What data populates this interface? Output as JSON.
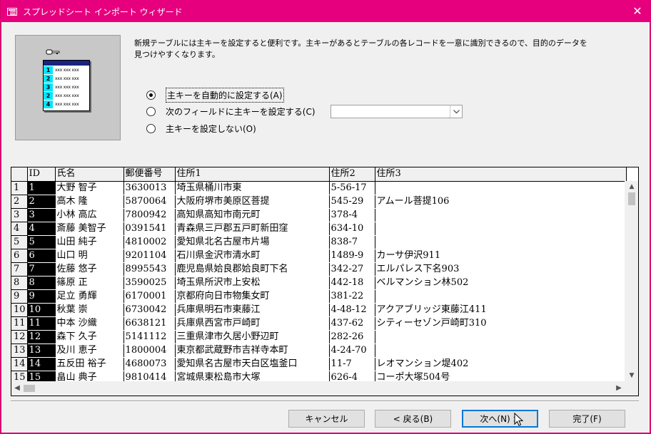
{
  "window": {
    "title": "スプレッドシート インポート ウィザード",
    "close_glyph": "✕"
  },
  "preview": {
    "row_keys": [
      "1",
      "2",
      "3",
      "2",
      "4"
    ],
    "cell_text": "xxx xxx xxx"
  },
  "description": "新規テーブルには主キーを設定すると便利です。主キーがあるとテーブルの各レコードを一意に識別できるので、目的のデータを見つけやすくなります。",
  "options": [
    {
      "label": "主キーを自動的に設定する(A)",
      "checked": true
    },
    {
      "label": "次のフィールドに主キーを設定する(C)",
      "checked": false
    },
    {
      "label": "主キーを設定しない(O)",
      "checked": false
    }
  ],
  "field_combo": {
    "value": ""
  },
  "grid": {
    "columns": [
      "",
      "ID",
      "氏名",
      "郵便番号",
      "住所1",
      "住所2",
      "住所3"
    ],
    "rows": [
      [
        "1",
        "1",
        "大野 智子",
        "3630013",
        "埼玉県桶川市東",
        "5-56-17",
        ""
      ],
      [
        "2",
        "2",
        "高木 隆",
        "5870064",
        "大阪府堺市美原区菩提",
        "545-29",
        "アムール菩提106"
      ],
      [
        "3",
        "3",
        "小林 高広",
        "7800942",
        "高知県高知市南元町",
        "378-4",
        ""
      ],
      [
        "4",
        "4",
        "斎藤 美智子",
        "0391541",
        "青森県三戸郡五戸町新田窪",
        "634-10",
        ""
      ],
      [
        "5",
        "5",
        "山田 純子",
        "4810002",
        "愛知県北名古屋市片場",
        "838-7",
        ""
      ],
      [
        "6",
        "6",
        "山口 明",
        "9201104",
        "石川県金沢市清水町",
        "1489-9",
        "カーサ伊沢911"
      ],
      [
        "7",
        "7",
        "佐藤 悠子",
        "8995543",
        "鹿児島県姶良郡姶良町下名",
        "342-27",
        "エルパレス下名903"
      ],
      [
        "8",
        "8",
        "篠原 正",
        "3590025",
        "埼玉県所沢市上安松",
        "442-18",
        "ベルマンション林502"
      ],
      [
        "9",
        "9",
        "足立 勇輝",
        "6170001",
        "京都府向日市物集女町",
        "381-22",
        ""
      ],
      [
        "10",
        "10",
        "秋葉 崇",
        "6730042",
        "兵庫県明石市東藤江",
        "4-48-12",
        "アクアブリッジ東藤江411"
      ],
      [
        "11",
        "11",
        "中本 沙織",
        "6638121",
        "兵庫県西宮市戸崎町",
        "437-62",
        "シティーセゾン戸崎町310"
      ],
      [
        "12",
        "12",
        "森下 久子",
        "5141112",
        "三重県津市久居小野辺町",
        "282-26",
        ""
      ],
      [
        "13",
        "13",
        "及川 恵子",
        "1800004",
        "東京都武蔵野市吉祥寺本町",
        "4-24-70",
        ""
      ],
      [
        "14",
        "14",
        "五反田 裕子",
        "4680073",
        "愛知県名古屋市天白区塩釜口",
        "11-7",
        "レオマンション堤402"
      ],
      [
        "15",
        "15",
        "畠山 典子",
        "9810414",
        "宮城県東松島市大塚",
        "626-4",
        "コーポ大塚504号"
      ]
    ]
  },
  "buttons": {
    "cancel": "キャンセル",
    "back": "< 戻る(B)",
    "next": "次へ(N) >",
    "finish": "完了(F)"
  }
}
